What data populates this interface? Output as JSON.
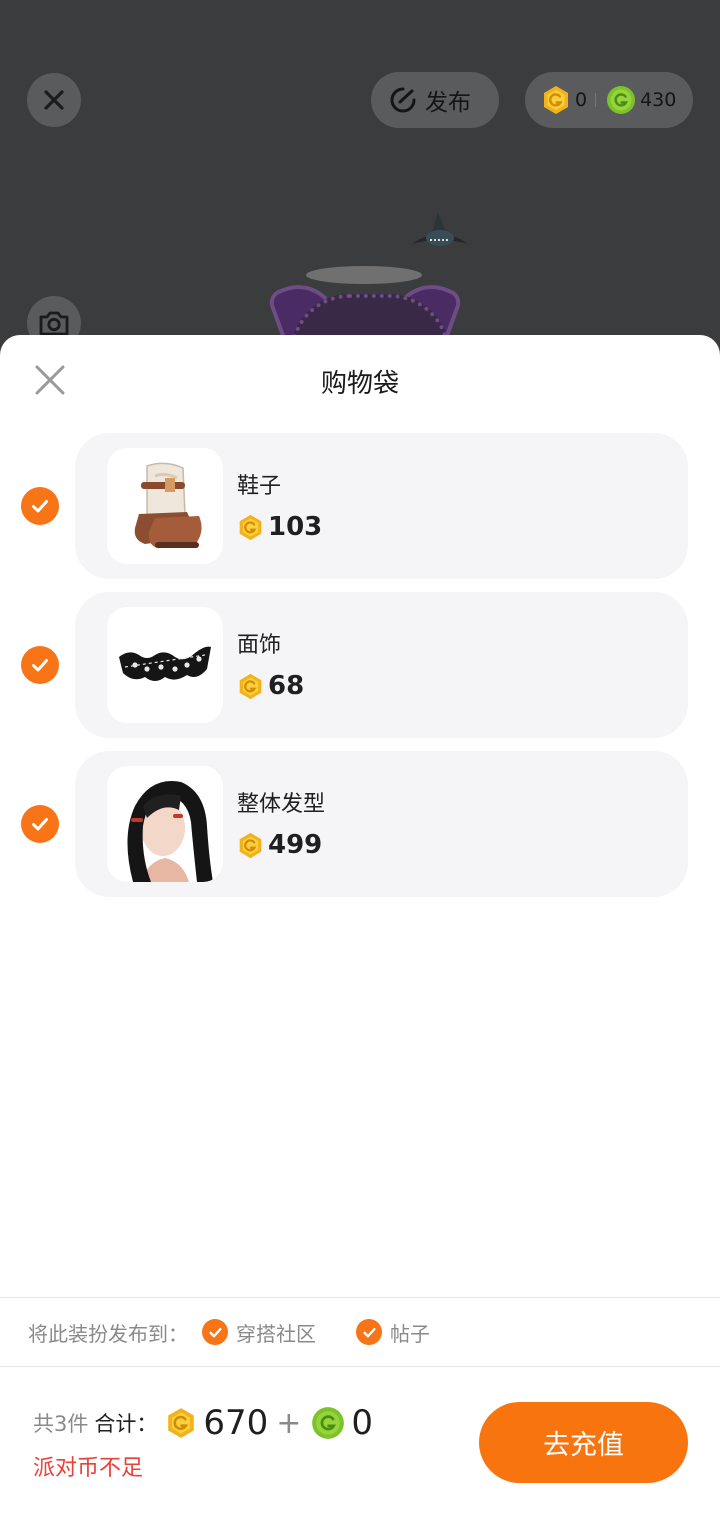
{
  "topbar": {
    "publish_label": "发布",
    "gold_balance": "0",
    "green_balance": "430"
  },
  "sheet": {
    "title": "购物袋",
    "items": [
      {
        "name": "鞋子",
        "price": "103",
        "checked": true
      },
      {
        "name": "面饰",
        "price": "68",
        "checked": true
      },
      {
        "name": "整体发型",
        "price": "499",
        "checked": true
      }
    ],
    "publish_to": {
      "label": "将此装扮发布到：",
      "options": [
        {
          "label": "穿搭社区",
          "checked": true
        },
        {
          "label": "帖子",
          "checked": true
        }
      ]
    },
    "footer": {
      "count": "共3件",
      "total_label": "合计：",
      "gold_total": "670",
      "plus": "+",
      "green_total": "0",
      "warning": "派对币不足",
      "button": "去充值"
    }
  },
  "colors": {
    "accent": "#f7740f",
    "warning": "#e8413a",
    "gold": "#f3b21a",
    "green": "#7cc22a"
  },
  "icons": [
    "close-icon",
    "camera-icon",
    "publish-icon",
    "gold-coin-icon",
    "green-coin-icon",
    "check-icon"
  ]
}
